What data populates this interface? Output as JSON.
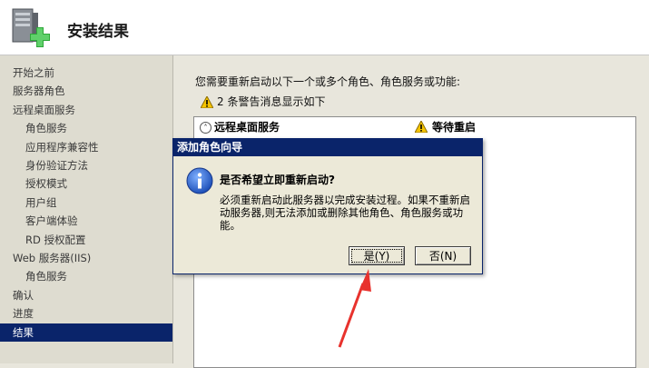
{
  "header": {
    "title": "安装结果"
  },
  "sidebar": {
    "items": [
      {
        "label": "开始之前",
        "level": 1,
        "active": false
      },
      {
        "label": "服务器角色",
        "level": 1,
        "active": false
      },
      {
        "label": "远程桌面服务",
        "level": 1,
        "active": false
      },
      {
        "label": "角色服务",
        "level": 2,
        "active": false
      },
      {
        "label": "应用程序兼容性",
        "level": 2,
        "active": false
      },
      {
        "label": "身份验证方法",
        "level": 2,
        "active": false
      },
      {
        "label": "授权模式",
        "level": 2,
        "active": false
      },
      {
        "label": "用户组",
        "level": 2,
        "active": false
      },
      {
        "label": "客户端体验",
        "level": 2,
        "active": false
      },
      {
        "label": "RD 授权配置",
        "level": 2,
        "active": false
      },
      {
        "label": "Web 服务器(IIS)",
        "level": 1,
        "active": false
      },
      {
        "label": "角色服务",
        "level": 2,
        "active": false
      },
      {
        "label": "确认",
        "level": 1,
        "active": false
      },
      {
        "label": "进度",
        "level": 1,
        "active": false
      },
      {
        "label": "结果",
        "level": 1,
        "active": true
      }
    ]
  },
  "main": {
    "intro": "您需要重新启动以下一个或多个角色、角色服务或功能:",
    "warning_summary": "2 条警告消息显示如下",
    "result": {
      "name": "远程桌面服务",
      "status": "等待重启"
    }
  },
  "dialog": {
    "title": "添加角色向导",
    "heading": "是否希望立即重新启动?",
    "body": "必须重新启动此服务器以完成安装过程。如果不重新启动服务器,则无法添加或删除其他角色、角色服务或功能。",
    "yes_label": "是(Y)",
    "no_label": "否(N)"
  },
  "colors": {
    "accent": "#0a246a",
    "annotation_arrow": "#e8322d"
  }
}
